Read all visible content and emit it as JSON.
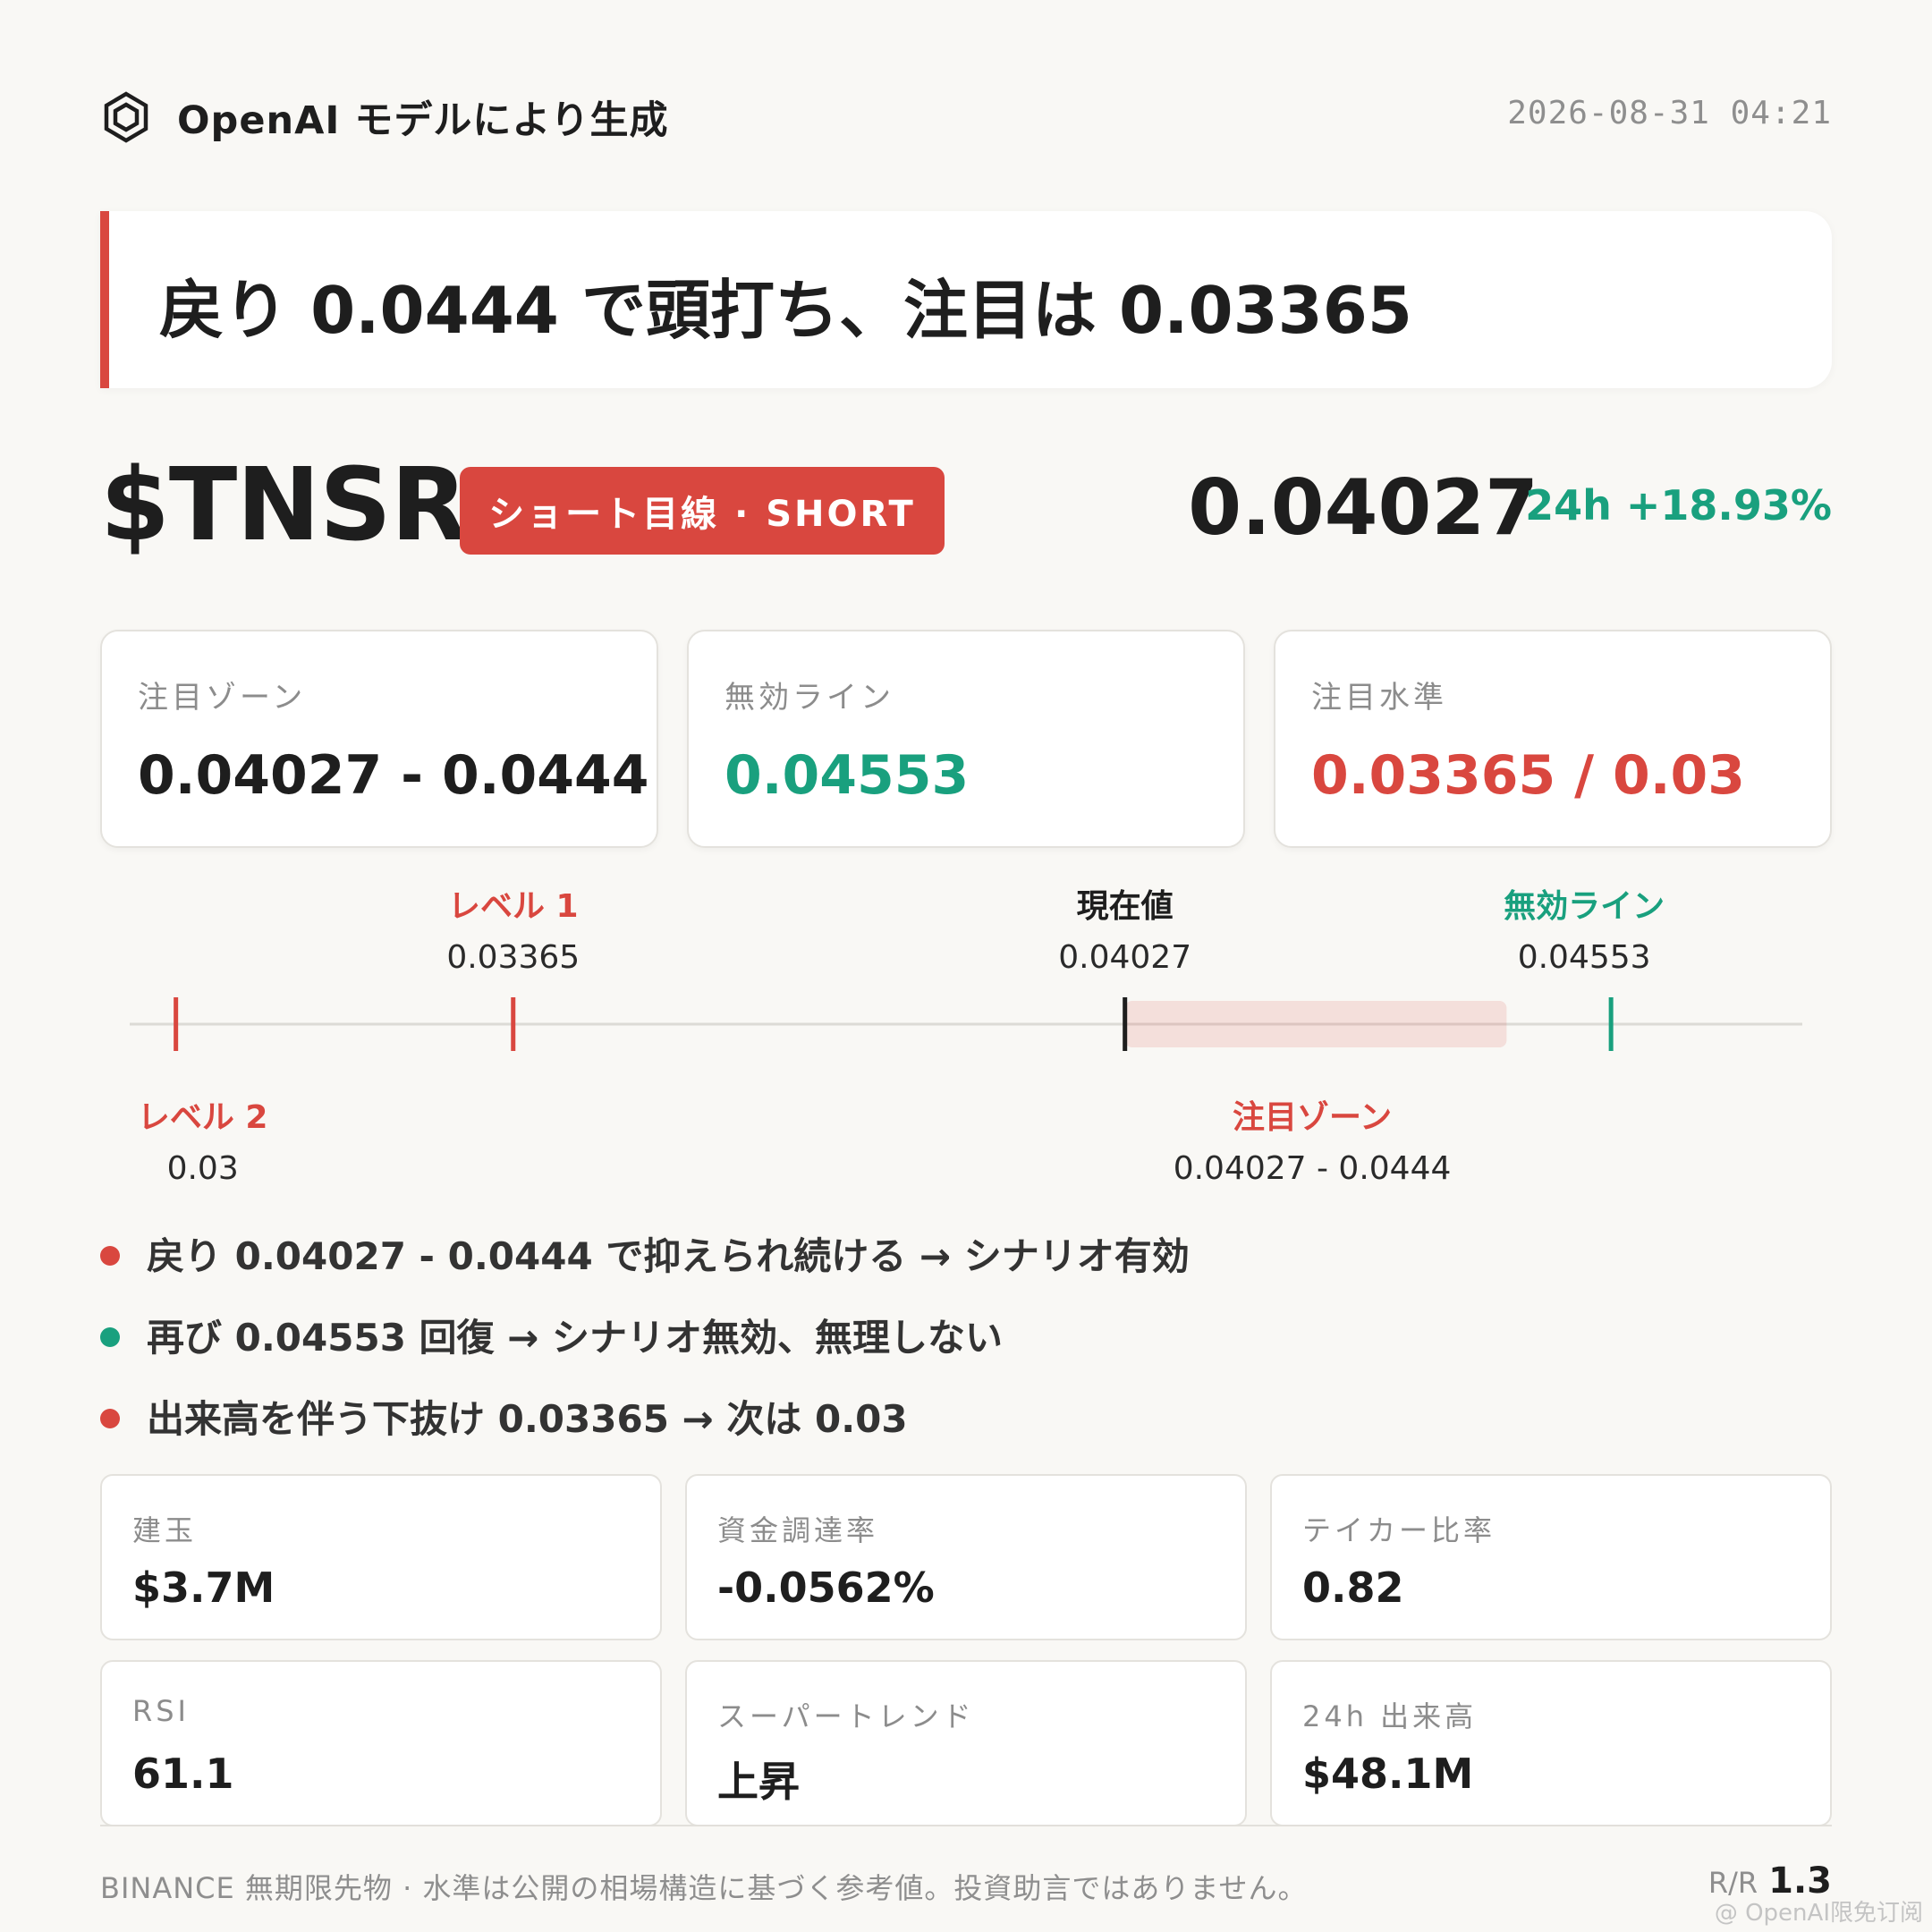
{
  "header": {
    "brand": "OpenAI モデルにより生成",
    "timestamp": "2026-08-31 04:21"
  },
  "headline": "戻り 0.0444 で頭打ち、注目は 0.03365",
  "ticker": {
    "symbol": "$TNSR",
    "badge": "ショート目線 · SHORT",
    "price": "0.04027",
    "change": "24h +18.93%"
  },
  "cards": [
    {
      "label": "注目ゾーン",
      "value": "0.04027 - 0.0444"
    },
    {
      "label": "無効ライン",
      "value": "0.04553"
    },
    {
      "label": "注目水準",
      "value": "0.03365 / 0.03"
    }
  ],
  "scale": {
    "min": 0.0295,
    "max": 0.0476,
    "markers": [
      {
        "title": "レベル 2",
        "value": "0.03",
        "price": 0.03,
        "color": "#d9473f",
        "label_pos": "below"
      },
      {
        "title": "レベル 1",
        "value": "0.03365",
        "price": 0.03365,
        "color": "#d9473f",
        "label_pos": "above"
      },
      {
        "title": "現在値",
        "value": "0.04027",
        "price": 0.04027,
        "color": "#1e1e1e",
        "label_pos": "above"
      },
      {
        "title": "無効ライン",
        "value": "0.04553",
        "price": 0.04553,
        "color": "#19a07e",
        "label_pos": "above"
      }
    ],
    "zone": {
      "title": "注目ゾーン",
      "value": "0.04027 - 0.0444",
      "from": 0.04027,
      "to": 0.0444,
      "color": "#d9473f"
    }
  },
  "bullets": [
    {
      "text": "戻り 0.04027 - 0.0444 で抑えられ続ける → シナリオ有効",
      "color": "#d9473f"
    },
    {
      "text": "再び 0.04553 回復 → シナリオ無効、無理しない",
      "color": "#19a07e"
    },
    {
      "text": "出来高を伴う下抜け 0.03365 → 次は 0.03",
      "color": "#d9473f"
    }
  ],
  "stats": [
    {
      "label": "建玉",
      "value": "$3.7M"
    },
    {
      "label": "資金調達率",
      "value": "-0.0562%"
    },
    {
      "label": "テイカー比率",
      "value": "0.82"
    },
    {
      "label": "RSI",
      "value": "61.1"
    },
    {
      "label": "スーパートレンド",
      "value": "上昇"
    },
    {
      "label": "24h 出来高",
      "value": "$48.1M"
    }
  ],
  "footer": {
    "disclaimer": "BINANCE 無期限先物 · 水準は公開の相場構造に基づく参考値。投資助言ではありません。",
    "rr_label": "R/R",
    "rr_value": "1.3",
    "watermark": "@ OpenAI限免订阅"
  },
  "colors": {
    "red": "#d9473f",
    "green": "#19a07e",
    "text": "#1e1e1e",
    "muted": "#8c8c8c"
  }
}
